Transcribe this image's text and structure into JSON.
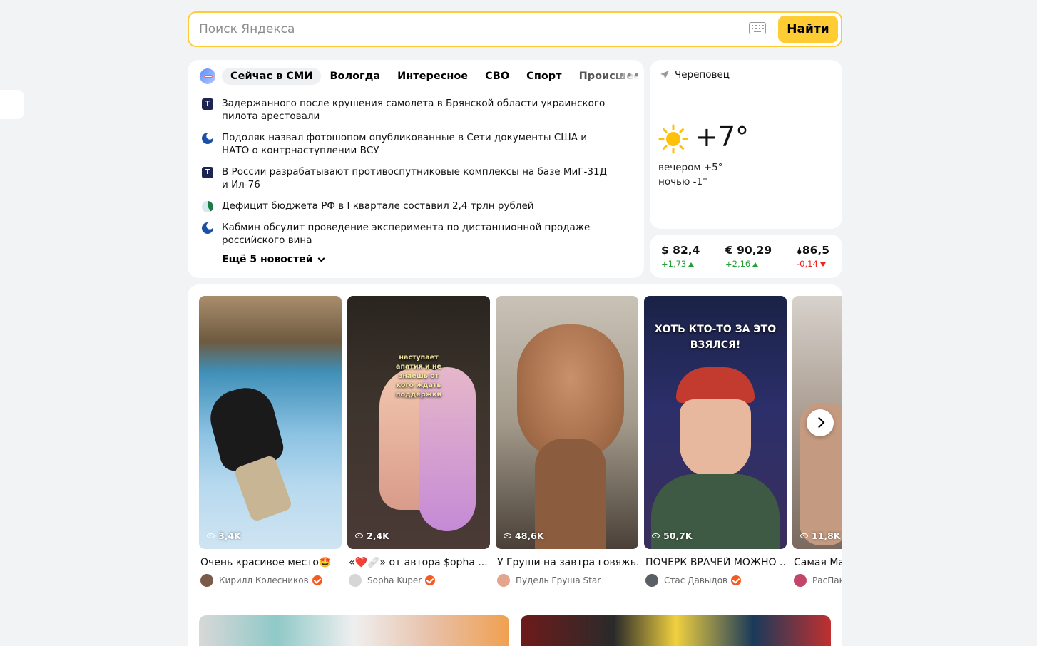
{
  "search": {
    "placeholder": "Поиск Яндекса",
    "button_label": "Найти"
  },
  "news": {
    "tabs": [
      "Сейчас в СМИ",
      "Вологда",
      "Интересное",
      "СВО",
      "Спорт",
      "Происшествия"
    ],
    "items": [
      {
        "source_icon": "t-letter-icon",
        "text": "Задержанного после крушения самолета в Брянской области украинского пилота арестовали"
      },
      {
        "source_icon": "globe-icon",
        "text": "Подоляк назвал фотошопом опубликованные в Сети документы США и НАТО о контрнаступлении ВСУ"
      },
      {
        "source_icon": "t-letter-icon",
        "text": "В России разрабатывают противоспутниковые комплексы на базе МиГ-31Д и Ил-76"
      },
      {
        "source_icon": "leaf-icon",
        "text": "Дефицит бюджета РФ в I квартале составил 2,4 трлн рублей"
      },
      {
        "source_icon": "globe-icon",
        "text": "Кабмин обсудит проведение эксперимента по дистанционной продаже российского вина"
      }
    ],
    "more_label": "Ещё 5 новостей"
  },
  "weather": {
    "city": "Череповец",
    "temperature": "+7°",
    "evening": "вечером +5°",
    "night": "ночью -1°"
  },
  "rates": [
    {
      "value": "$ 82,4",
      "change": "+1,73",
      "direction": "up"
    },
    {
      "value": "€ 90,29",
      "change": "+2,16",
      "direction": "up"
    },
    {
      "value": "86,5",
      "change": "-0,14",
      "direction": "down"
    }
  ],
  "videos": [
    {
      "views": "3,4K",
      "title": "Очень красивое место🤩",
      "author": "Кирилл Колесников",
      "verified": true
    },
    {
      "views": "2,4K",
      "title": "«❤️🩹» от автора $opha ...",
      "author": "Sophа Kuper",
      "verified": true,
      "overlay": "наступает апатия и не знаешь от кого ждать поддержки"
    },
    {
      "views": "48,6K",
      "title": "У Груши на завтра говяжь...",
      "author": "Пудель Груша Star",
      "verified": false
    },
    {
      "views": "50,7K",
      "title": "ПОЧЕРК ВРАЧЕЙ МОЖНО ...",
      "author": "Стас Давыдов",
      "verified": true,
      "overlay": "ХОТЬ КТО-ТО ЗА ЭТО ВЗЯЛСЯ!"
    },
    {
      "views": "11,8K",
      "title": "Самая Ма",
      "author": "РасПак",
      "verified": false
    }
  ],
  "colors": {
    "accent_yellow": "#ffcc33",
    "up_green": "#21a038",
    "down_red": "#ee2222",
    "verified_orange": "#f55a20"
  }
}
